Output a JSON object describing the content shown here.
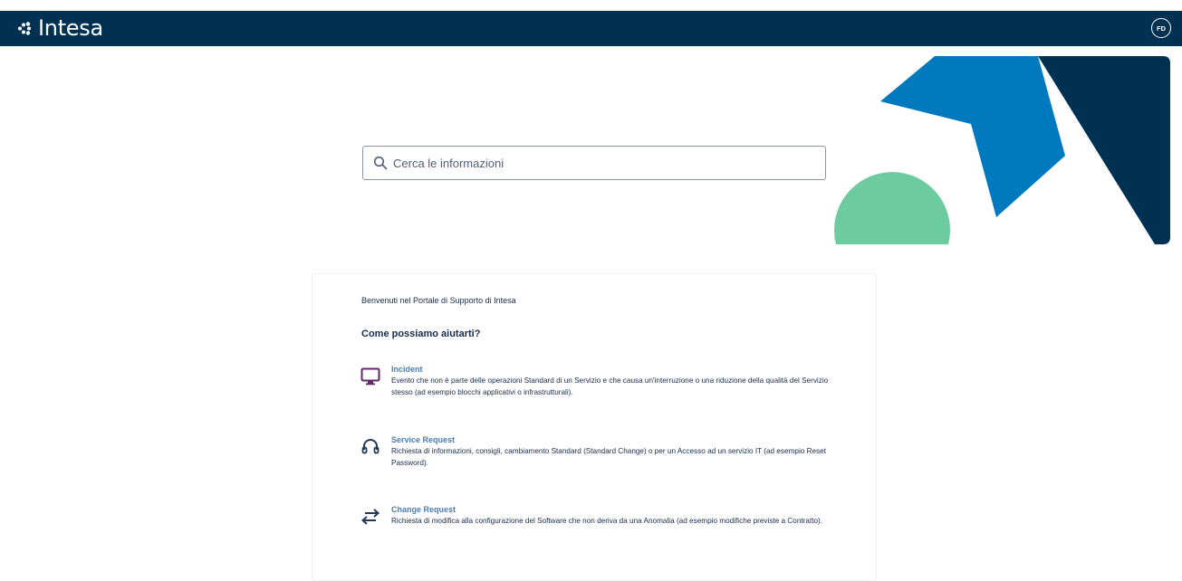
{
  "header": {
    "brand": "Intesa",
    "user_initials": "FD",
    "color": "#003153"
  },
  "search": {
    "placeholder": "Cerca le informazioni",
    "icon": "search-icon"
  },
  "hero_colors": {
    "dark_blue": "#003153",
    "mid_blue": "#0079bf",
    "green": "#6ccca0"
  },
  "main": {
    "welcome": "Benvenuti nel Portale di Supporto di Intesa",
    "heading": "Come possiamo aiutarti?",
    "request_types": [
      {
        "title": "Incident",
        "icon": "monitor-icon",
        "description": "Evento che non è parte delle operazioni Standard di un Servizio e che causa un'interruzione o una riduzione della qualità del Servizio stesso (ad esempio blocchi applicativi o infrastrutturali)."
      },
      {
        "title": "Service Request",
        "icon": "headset-icon",
        "description": "Richiesta di informazioni, consigli, cambiamento Standard (Standard Change) o per un Accesso ad un servizio IT (ad esempio Reset Password)."
      },
      {
        "title": "Change Request",
        "icon": "swap-arrows-icon",
        "description": "Richiesta di modifica alla configurazione del Software che non deriva da una Anomalia (ad esempio modifiche previste a Contratto)."
      }
    ]
  }
}
